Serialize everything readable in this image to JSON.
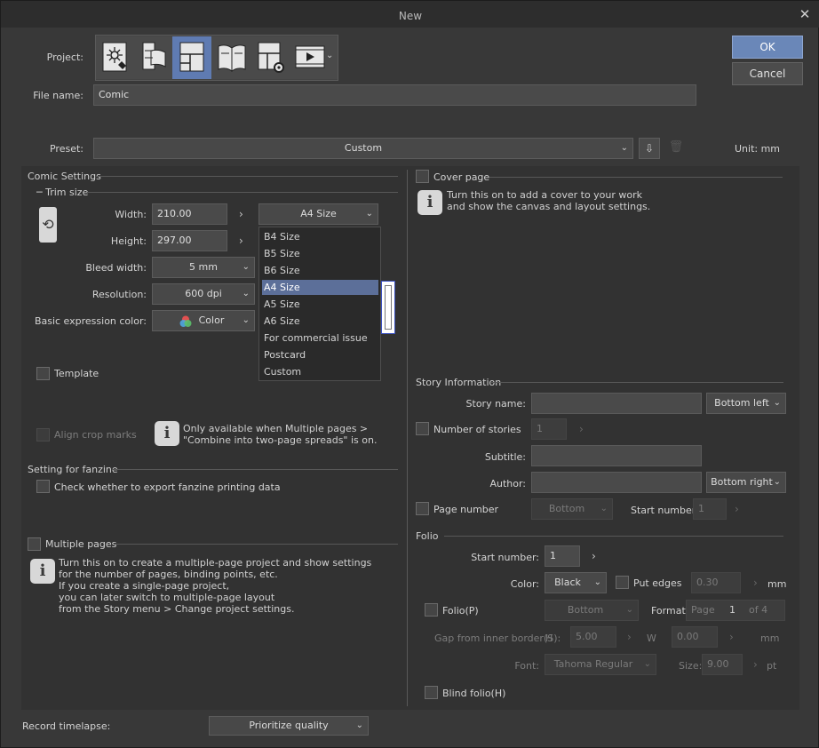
{
  "window": {
    "title": "New"
  },
  "buttons": {
    "ok": "OK",
    "cancel": "Cancel"
  },
  "project": {
    "label": "Project:",
    "types": [
      {
        "icon": "illustration-icon",
        "selected": false
      },
      {
        "icon": "webtoon-icon",
        "selected": false
      },
      {
        "icon": "comic-icon",
        "selected": true
      },
      {
        "icon": "book-icon",
        "selected": false
      },
      {
        "icon": "page-settings-icon",
        "selected": false
      },
      {
        "icon": "animation-icon",
        "selected": false
      }
    ]
  },
  "file_name": {
    "label": "File name:",
    "value": "Comic"
  },
  "preset": {
    "label": "Preset:",
    "value": "Custom",
    "unit": "Unit:  mm"
  },
  "comic_settings": {
    "title": "Comic Settings",
    "trim_size": "Trim size",
    "width": {
      "label": "Width:",
      "value": "210.00",
      "size": "A4 Size"
    },
    "height": {
      "label": "Height:",
      "value": "297.00"
    },
    "bleed": {
      "label": "Bleed width:",
      "value": "5 mm"
    },
    "resolution": {
      "label": "Resolution:",
      "value": "600 dpi"
    },
    "color": {
      "label": "Basic expression color:",
      "value": "Color"
    },
    "template": "Template",
    "align_crop": "Align crop marks",
    "align_info": "Only available when Multiple pages >\n\"Combine into two-page spreads\" is on."
  },
  "size_dropdown": {
    "items": [
      "B4 Size",
      "B5 Size",
      "B6 Size",
      "A4 Size",
      "A5 Size",
      "A6 Size",
      "For commercial issue",
      "Postcard",
      "Custom"
    ],
    "selected_index": 3
  },
  "fanzine": {
    "title": "Setting for fanzine",
    "check": "Check whether to export fanzine printing data"
  },
  "multiple_pages": {
    "label": "Multiple pages",
    "info": "Turn this on to create a multiple-page project and show settings\nfor the number of pages, binding points, etc.\nIf you create a single-page project,\nyou can later switch to multiple-page layout\nfrom the Story menu > Change project settings."
  },
  "cover_page": {
    "label": "Cover page",
    "info": "Turn this on to add a cover to your work\nand show the canvas and layout settings."
  },
  "story_info": {
    "title": "Story Information",
    "story_name": {
      "label": "Story name:",
      "position": "Bottom left"
    },
    "number_of_stories": {
      "label": "Number of stories",
      "value": "1"
    },
    "subtitle": {
      "label": "Subtitle:"
    },
    "author": {
      "label": "Author:",
      "position": "Bottom right"
    },
    "page_number": {
      "label": "Page number",
      "position": "Bottom",
      "start_label": "Start number:",
      "start_value": "1"
    }
  },
  "folio": {
    "title": "Folio",
    "start_number": {
      "label": "Start number:",
      "value": "1"
    },
    "color": {
      "label": "Color:",
      "value": "Black"
    },
    "put_edges": {
      "label": "Put edges",
      "value": "0.30",
      "unit": "mm"
    },
    "folio_p": {
      "label": "Folio(P)",
      "position": "Bottom",
      "format_label": "Format:",
      "format_page": "Page",
      "format_num": "1",
      "format_of": "of 4"
    },
    "gap": {
      "label": "Gap from inner border(S):",
      "h_label": "H",
      "h_value": "5.00",
      "w_label": "W",
      "w_value": "0.00",
      "unit": "mm"
    },
    "font": {
      "label": "Font:",
      "value": "Tahoma Regular",
      "size_label": "Size:",
      "size_value": "9.00",
      "unit": "pt"
    },
    "blind": "Blind folio(H)"
  },
  "timelapse": {
    "label": "Record timelapse:",
    "value": "Prioritize quality"
  }
}
